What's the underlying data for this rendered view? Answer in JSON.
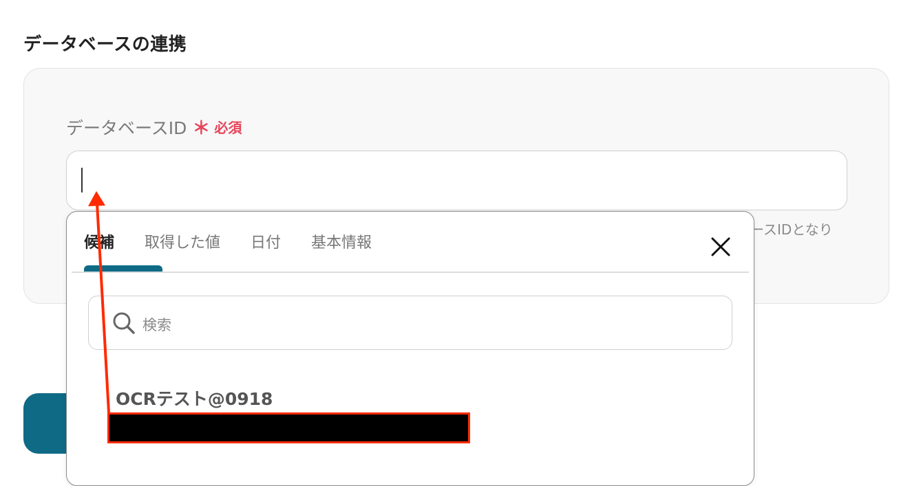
{
  "section": {
    "title": "データベースの連携"
  },
  "field": {
    "label": "データベースID",
    "required_mark": "＊",
    "required_text": "必須",
    "value": "",
    "hint_fragment": "ースIDとなり"
  },
  "dropdown": {
    "tabs": [
      {
        "label": "候補",
        "active": true
      },
      {
        "label": "取得した値",
        "active": false
      },
      {
        "label": "日付",
        "active": false
      },
      {
        "label": "基本情報",
        "active": false
      }
    ],
    "search": {
      "placeholder": "検索"
    },
    "candidates": [
      {
        "title": "OCRテスト@0918"
      }
    ],
    "icons": {
      "close": "close-icon",
      "search": "search-icon"
    }
  },
  "colors": {
    "accent": "#0f6a86",
    "required": "#e8445a",
    "annotation": "#ff2a00"
  }
}
